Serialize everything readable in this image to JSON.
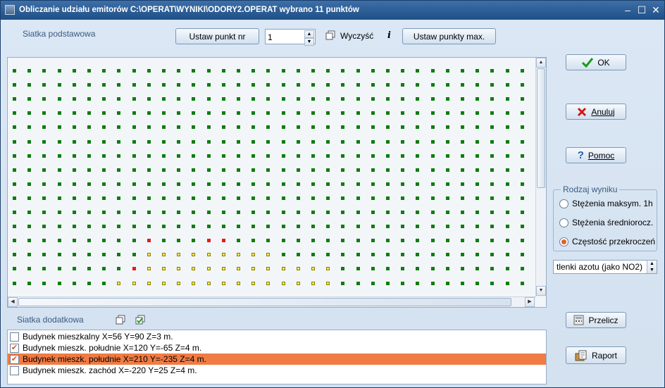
{
  "window": {
    "title": "Obliczanie udziału emitorów C:\\OPERAT\\WYNIKI\\ODORY2.OPERAT   wybrano 11 punktów"
  },
  "toolbar": {
    "basic_grid_label": "Siatka podstawowa",
    "set_point_label": "Ustaw punkt nr",
    "point_number": "1",
    "clear_label": "Wyczyść",
    "info_label": "i",
    "set_max_label": "Ustaw punkty max."
  },
  "grid": {
    "columns": 36,
    "rows": 15,
    "colors": {
      "normal": "#0f7d0f",
      "selected": "#e81a1a",
      "exceeded": "#f2e84d",
      "exceeded_border": "#8a7f00"
    },
    "selected_points": [
      [
        9,
        12
      ],
      [
        13,
        12
      ],
      [
        14,
        12
      ],
      [
        8,
        14
      ]
    ],
    "exceeded_points": [
      [
        9,
        13
      ],
      [
        10,
        13
      ],
      [
        11,
        13
      ],
      [
        12,
        13
      ],
      [
        13,
        13
      ],
      [
        14,
        13
      ],
      [
        15,
        13
      ],
      [
        16,
        13
      ],
      [
        17,
        13
      ],
      [
        9,
        14
      ],
      [
        10,
        14
      ],
      [
        11,
        14
      ],
      [
        12,
        14
      ],
      [
        13,
        14
      ],
      [
        14,
        14
      ],
      [
        15,
        14
      ],
      [
        16,
        14
      ],
      [
        17,
        14
      ],
      [
        18,
        14
      ],
      [
        19,
        14
      ],
      [
        20,
        14
      ],
      [
        21,
        14
      ],
      [
        7,
        15
      ],
      [
        8,
        15
      ],
      [
        9,
        15
      ],
      [
        10,
        15
      ],
      [
        11,
        15
      ],
      [
        12,
        15
      ],
      [
        13,
        15
      ],
      [
        14,
        15
      ],
      [
        15,
        15
      ],
      [
        16,
        15
      ],
      [
        17,
        15
      ],
      [
        18,
        15
      ],
      [
        19,
        15
      ],
      [
        20,
        15
      ],
      [
        21,
        15
      ]
    ]
  },
  "extra": {
    "label": "Siatka dodatkowa",
    "items": [
      {
        "label": "Budynek mieszkalny  X=56 Y=90 Z=3 m.",
        "checked": false,
        "selected": false
      },
      {
        "label": "Budynek mieszk. południe  X=120 Y=-65 Z=4 m.",
        "checked": true,
        "selected": false
      },
      {
        "label": "Budynek mieszk. południe  X=210 Y=-235 Z=4 m.",
        "checked": true,
        "selected": true
      },
      {
        "label": "Budynek mieszk.  zachód  X=-220 Y=25 Z=4 m.",
        "checked": false,
        "selected": false
      }
    ]
  },
  "buttons": {
    "ok": "OK",
    "cancel": "Anuluj",
    "help": "Pomoc",
    "recalc": "Przelicz",
    "report": "Raport"
  },
  "result_type": {
    "legend": "Rodzaj wyniku",
    "options": [
      "Stężenia maksym. 1h",
      "Stężenia średniorocz.",
      "Częstość przekroczeń"
    ],
    "selected": 2
  },
  "substance": {
    "value": "tlenki azotu (jako NO2)"
  }
}
